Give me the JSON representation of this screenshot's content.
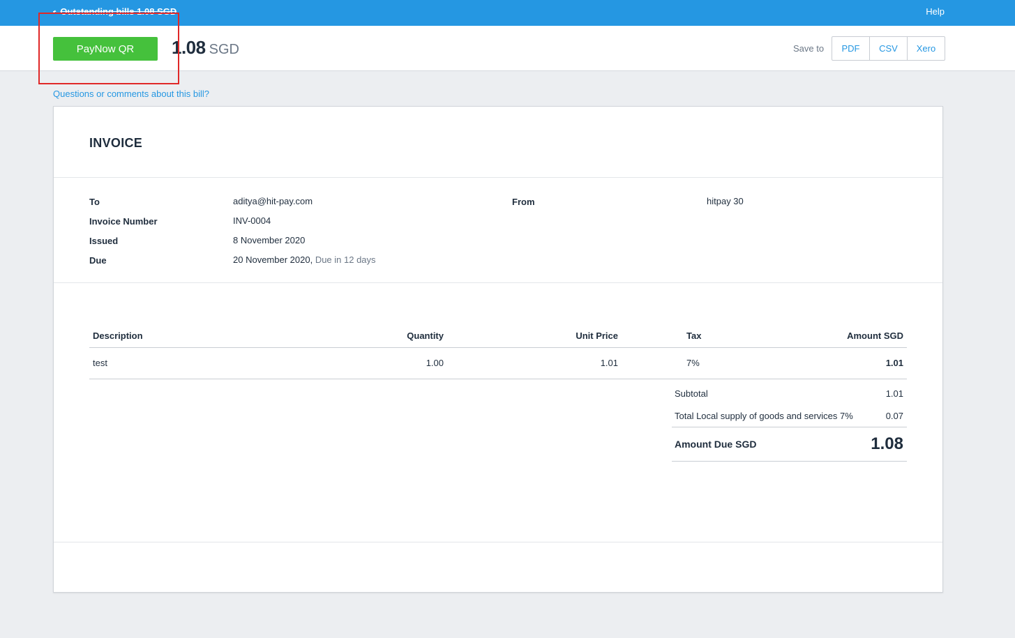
{
  "topbar": {
    "back_label": "Outstanding bills 1.08 SGD",
    "back_icon": "chevron-left-icon",
    "help_label": "Help"
  },
  "actionbar": {
    "pay_label": "PayNow QR",
    "amount": "1.08",
    "currency": "SGD",
    "save_to_label": "Save to",
    "save_options": [
      "PDF",
      "CSV",
      "Xero"
    ]
  },
  "questions_label": "Questions or comments about this bill?",
  "invoice": {
    "title": "INVOICE",
    "to_label": "To",
    "to_value": "aditya@hit-pay.com",
    "number_label": "Invoice Number",
    "number_value": "INV-0004",
    "issued_label": "Issued",
    "issued_value": "8 November 2020",
    "due_label": "Due",
    "due_value": "20 November 2020,",
    "due_note": "Due in 12 days",
    "from_label": "From",
    "from_value": "hitpay 30",
    "table": {
      "headers": [
        "Description",
        "Quantity",
        "Unit Price",
        "Tax",
        "Amount SGD"
      ],
      "rows": [
        {
          "description": "test",
          "quantity": "1.00",
          "unit_price": "1.01",
          "tax": "7%",
          "amount": "1.01"
        }
      ]
    },
    "totals": {
      "subtotal_label": "Subtotal",
      "subtotal_value": "1.01",
      "tax_label": "Total Local supply of goods and services 7%",
      "tax_value": "0.07",
      "amount_due_label": "Amount Due SGD",
      "amount_due_value": "1.08"
    }
  },
  "colors": {
    "topbar": "#2597e2",
    "pay_button": "#45c13c",
    "link": "#2597e2",
    "highlight": "#e02828"
  }
}
